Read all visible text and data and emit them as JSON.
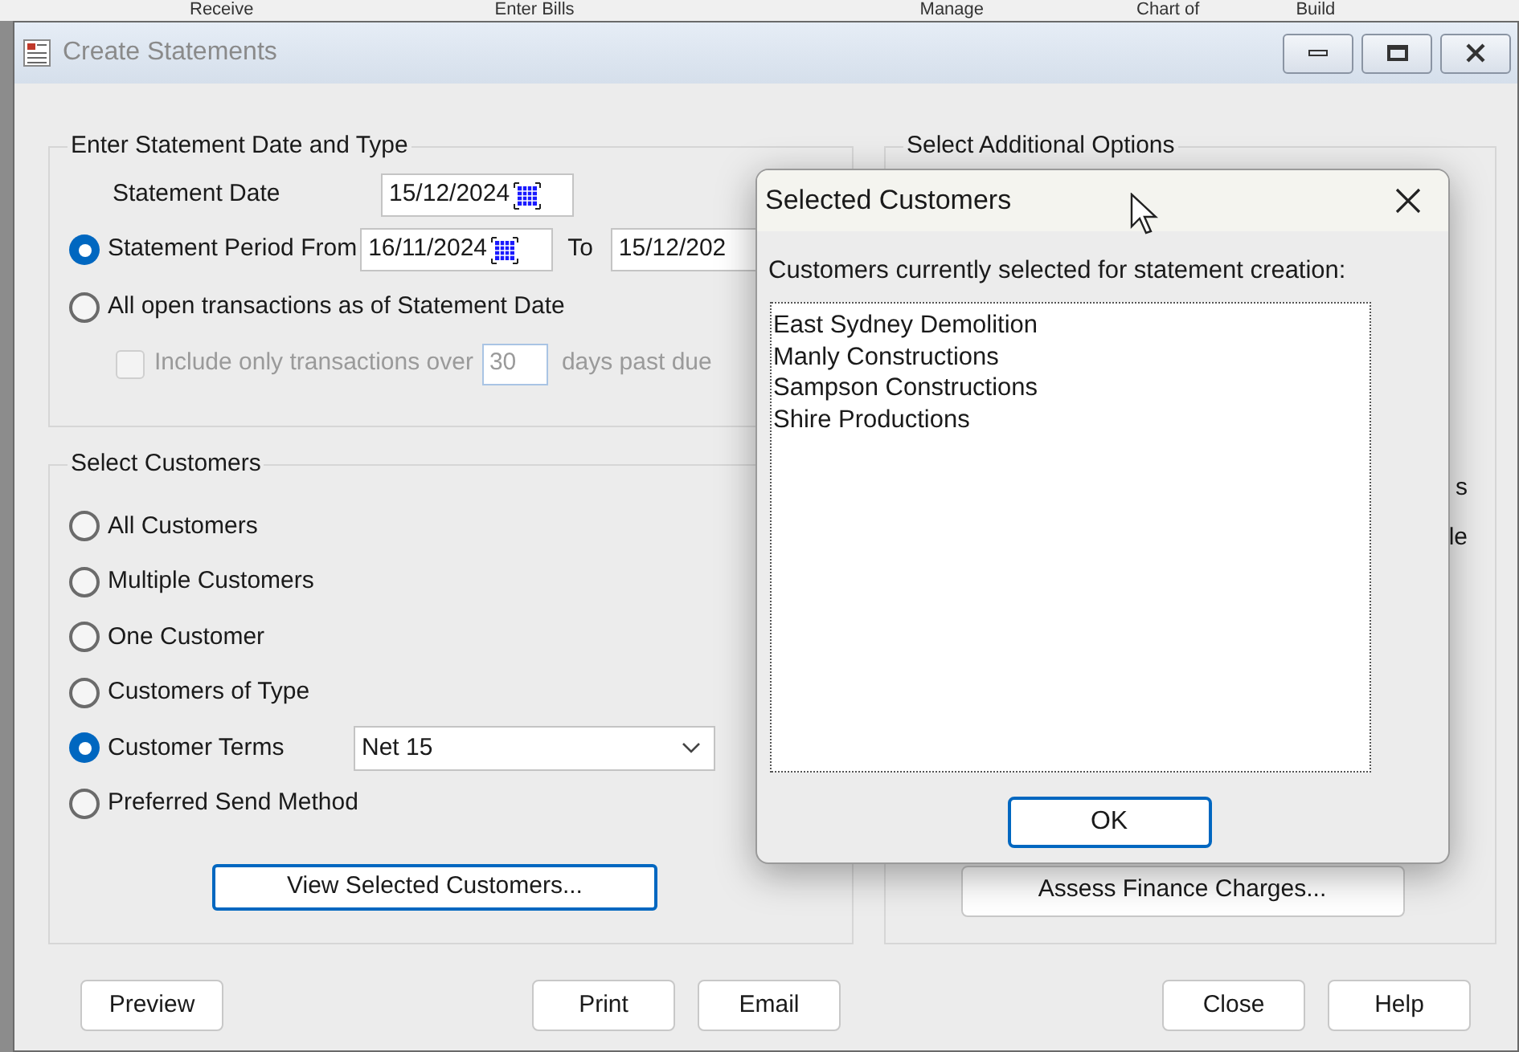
{
  "background_toolbar": [
    "Receive",
    "Enter Bills",
    "Manage",
    "Chart of",
    "Build"
  ],
  "window": {
    "title": "Create Statements"
  },
  "date_type": {
    "title": "Enter Statement Date and Type",
    "statement_date": {
      "label": "Statement Date",
      "value": "15/12/2024"
    },
    "options": [
      {
        "label": "Statement Period From",
        "selected": true,
        "from": "16/11/2024",
        "to_label": "To",
        "to": "15/12/202"
      },
      {
        "label": "All open transactions as of Statement Date",
        "selected": false
      }
    ],
    "overdue_filter": {
      "label": "Include only transactions over",
      "value": "30",
      "suffix": "days past due",
      "checked": false,
      "disabled": true
    }
  },
  "select_customers": {
    "title": "Select Customers",
    "options": [
      {
        "label": "All Customers",
        "selected": false
      },
      {
        "label": "Multiple Customers",
        "selected": false
      },
      {
        "label": "One Customer",
        "selected": false
      },
      {
        "label": "Customers of Type",
        "selected": false
      },
      {
        "label": "Customer Terms",
        "selected": true,
        "dropdown": "Net 15"
      },
      {
        "label": "Preferred Send Method",
        "selected": false
      }
    ],
    "view_button": "View Selected Customers..."
  },
  "additional_options": {
    "title": "Select Additional Options",
    "fragments": [
      "s",
      "le"
    ],
    "finance_button": "Assess Finance Charges..."
  },
  "footer": {
    "left": [
      "Preview"
    ],
    "center": [
      "Print",
      "Email"
    ],
    "right": [
      "Close",
      "Help"
    ]
  },
  "dialog": {
    "title": "Selected Customers",
    "prompt": "Customers currently selected for statement creation:",
    "customers": [
      "East Sydney Demolition",
      "Manly Constructions",
      "Sampson Constructions",
      "Shire Productions"
    ],
    "ok": "OK"
  }
}
